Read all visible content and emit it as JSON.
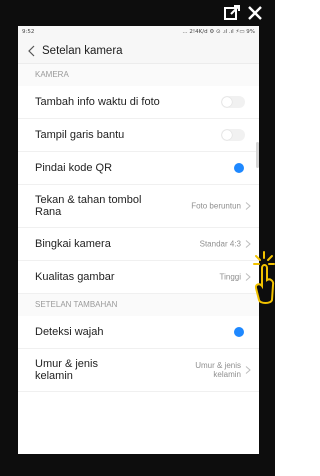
{
  "status_bar": {
    "time": "9:52",
    "indicators": "... 2!4K/d ⚙ ⊙ .ıl .ıl ⚡▭ 9%"
  },
  "toolbar_icons": [
    "open-external-icon",
    "close-icon"
  ],
  "header": {
    "title": "Setelan kamera",
    "back_icon": "chevron-left-icon"
  },
  "sections": [
    {
      "label": "KAMERA",
      "rows": [
        {
          "label": "Tambah info waktu di foto",
          "control": "toggle",
          "on": false
        },
        {
          "label": "Tampil garis bantu",
          "control": "toggle",
          "on": false
        },
        {
          "label": "Pindai kode QR",
          "control": "toggle",
          "on": true
        },
        {
          "label": "Tekan & tahan tombol Rana",
          "control": "value",
          "value": "Foto beruntun"
        },
        {
          "label": "Bingkai kamera",
          "control": "value",
          "value": "Standar 4:3"
        },
        {
          "label": "Kualitas gambar",
          "control": "value",
          "value": "Tinggi"
        }
      ]
    },
    {
      "label": "SETELAN TAMBAHAN",
      "rows": [
        {
          "label": "Deteksi wajah",
          "control": "toggle",
          "on": true
        },
        {
          "label": "Umur & jenis kelamin",
          "control": "value",
          "value": "Umur & jenis kelamin"
        }
      ]
    }
  ],
  "colors": {
    "accent": "#1e88ff",
    "frame": "#0d0d0d",
    "tap_graphic": "#f2c200"
  }
}
